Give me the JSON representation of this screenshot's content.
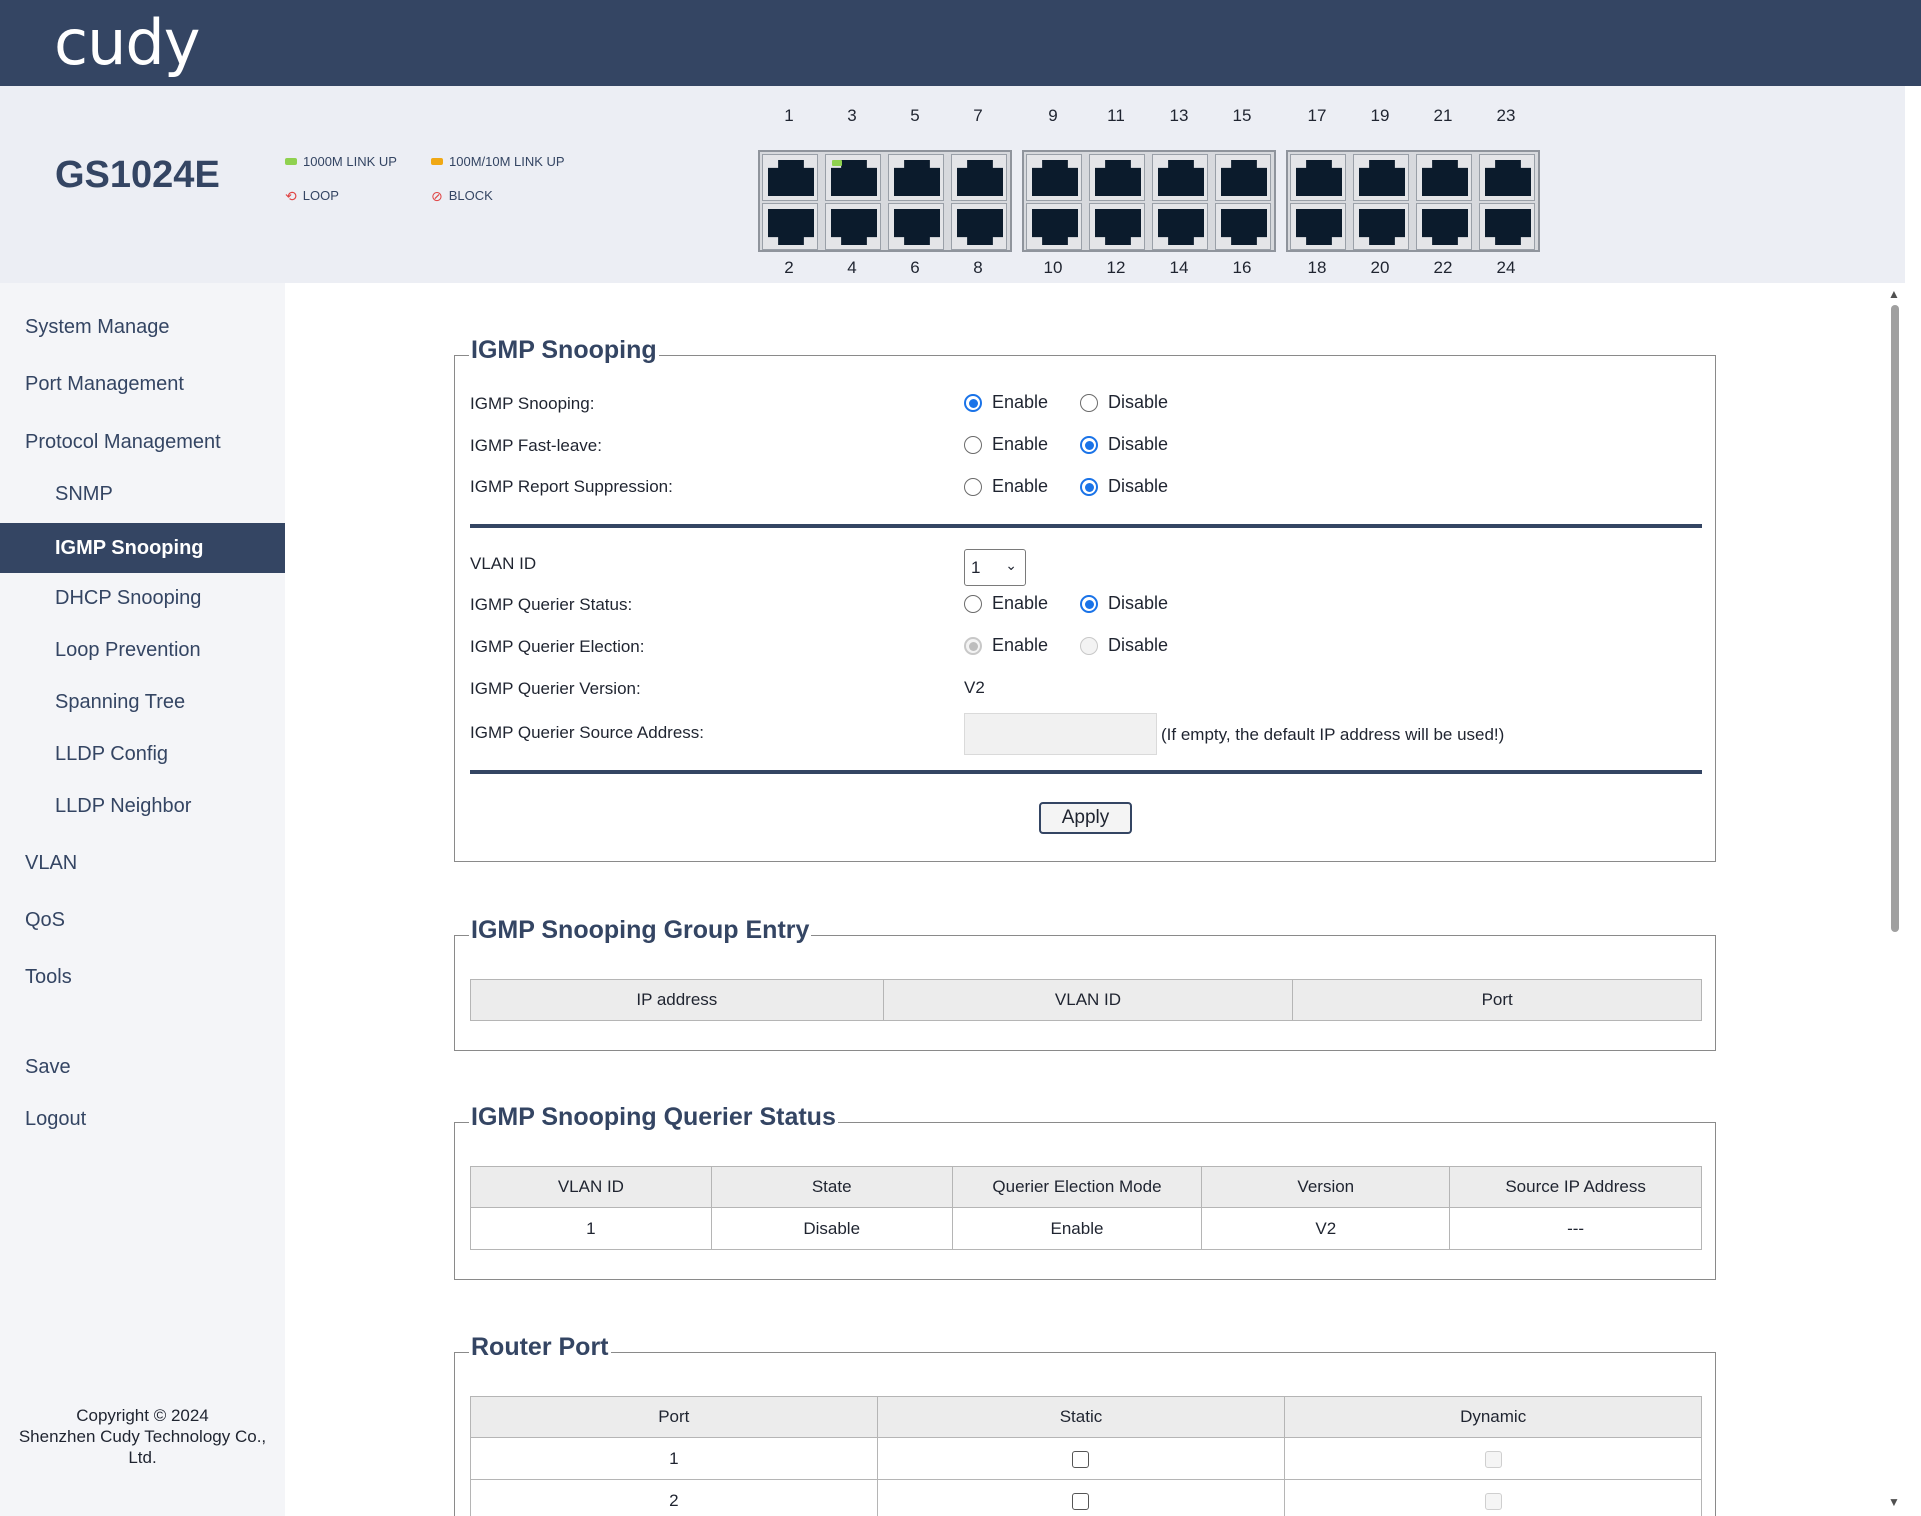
{
  "brand": {
    "logo": "cudy"
  },
  "device": {
    "model": "GS1024E",
    "legend": {
      "link_1000": "1000M LINK UP",
      "link_100": "100M/10M LINK UP",
      "loop": "LOOP",
      "block": "BLOCK"
    },
    "legend_colors": {
      "link_1000": "#8fd14f",
      "link_100": "#f0a814",
      "loop": "#e04545",
      "block": "#e04545"
    },
    "ports_top": [
      "1",
      "3",
      "5",
      "7",
      "9",
      "11",
      "13",
      "15",
      "17",
      "19",
      "21",
      "23"
    ],
    "ports_bottom": [
      "2",
      "4",
      "6",
      "8",
      "10",
      "12",
      "14",
      "16",
      "18",
      "20",
      "22",
      "24"
    ],
    "port_link": {
      "3": "1000M LINK UP"
    }
  },
  "sidebar": {
    "items": [
      {
        "label": "System Manage"
      },
      {
        "label": "Port Management"
      },
      {
        "label": "Protocol Management"
      },
      {
        "label": "SNMP"
      },
      {
        "label": "IGMP Snooping"
      },
      {
        "label": "DHCP Snooping"
      },
      {
        "label": "Loop Prevention"
      },
      {
        "label": "Spanning Tree"
      },
      {
        "label": "LLDP Config"
      },
      {
        "label": "LLDP Neighbor"
      },
      {
        "label": "VLAN"
      },
      {
        "label": "QoS"
      },
      {
        "label": "Tools"
      },
      {
        "label": "Save"
      },
      {
        "label": "Logout"
      }
    ],
    "active": "IGMP Snooping",
    "copyright": "Copyright © 2024",
    "company": "Shenzhen Cudy Technology Co.,",
    "company_suffix": "Ltd."
  },
  "igmp": {
    "title": "IGMP Snooping",
    "enable_label": "Enable",
    "disable_label": "Disable",
    "snooping_label": "IGMP Snooping:",
    "snooping_value": "Enable",
    "fast_leave_label": "IGMP Fast-leave:",
    "fast_leave_value": "Disable",
    "report_supp_label": "IGMP Report Suppression:",
    "report_supp_value": "Disable",
    "vlan_label": "VLAN ID",
    "vlan_value": "1",
    "querier_status_label": "IGMP Querier Status:",
    "querier_status_value": "Disable",
    "querier_election_label": "IGMP Querier Election:",
    "querier_election_value": "Enable",
    "querier_version_label": "IGMP Querier Version:",
    "querier_version_value": "V2",
    "querier_source_label": "IGMP Querier Source Address:",
    "querier_source_value": "",
    "querier_source_hint": "(If empty, the default IP address will be used!)",
    "apply_label": "Apply"
  },
  "group_entry": {
    "title": "IGMP Snooping Group Entry",
    "columns": [
      "IP address",
      "VLAN ID",
      "Port"
    ]
  },
  "querier_table": {
    "title": "IGMP Snooping Querier Status",
    "columns": [
      "VLAN ID",
      "State",
      "Querier Election Mode",
      "Version",
      "Source IP Address"
    ],
    "rows": [
      [
        "1",
        "Disable",
        "Enable",
        "V2",
        "---"
      ]
    ]
  },
  "router_port": {
    "title": "Router Port",
    "columns": [
      "Port",
      "Static",
      "Dynamic"
    ],
    "rows": [
      {
        "port": "1",
        "static": false,
        "dynamic": false
      },
      {
        "port": "2",
        "static": false,
        "dynamic": false
      }
    ]
  }
}
